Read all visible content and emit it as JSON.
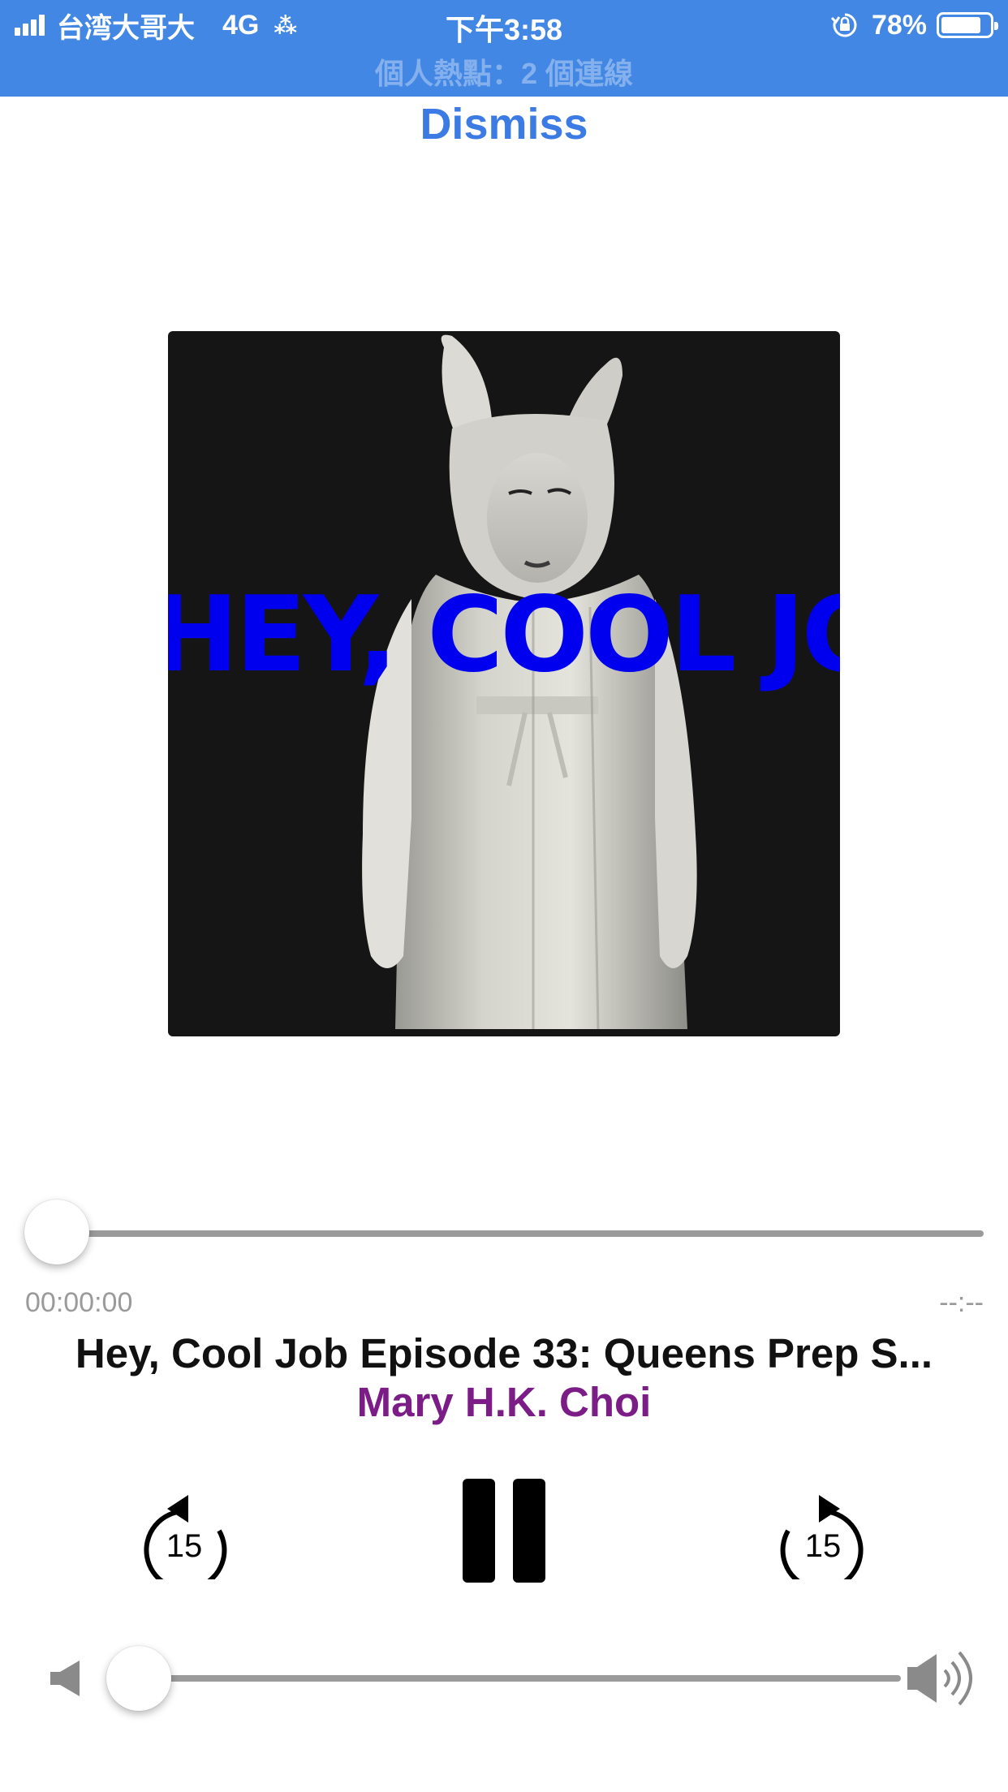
{
  "status_bar": {
    "carrier": "台湾大哥大",
    "network": "4G",
    "time": "下午3:58",
    "battery": "78%",
    "hotspot": "個人熱點：2 個連線",
    "bg_color": "#4287e4"
  },
  "header": {
    "dismiss_label": "Dismiss"
  },
  "artwork": {
    "title_text": "HEY, COOL JOB!"
  },
  "progress": {
    "elapsed": "00:00:00",
    "remaining": "--:--",
    "fraction": 0
  },
  "now_playing": {
    "episode_title": "Hey, Cool Job Episode 33: Queens Prep S...",
    "author": "Mary H.K. Choi"
  },
  "controls": {
    "skip_back_seconds": "15",
    "skip_forward_seconds": "15",
    "play_state": "playing"
  },
  "volume": {
    "level": 0.0
  },
  "icons": {
    "skip_back": "rewind-15-icon",
    "pause": "pause-icon",
    "skip_forward": "forward-15-icon",
    "volume_low": "speaker-low-icon",
    "volume_high": "speaker-high-icon"
  }
}
